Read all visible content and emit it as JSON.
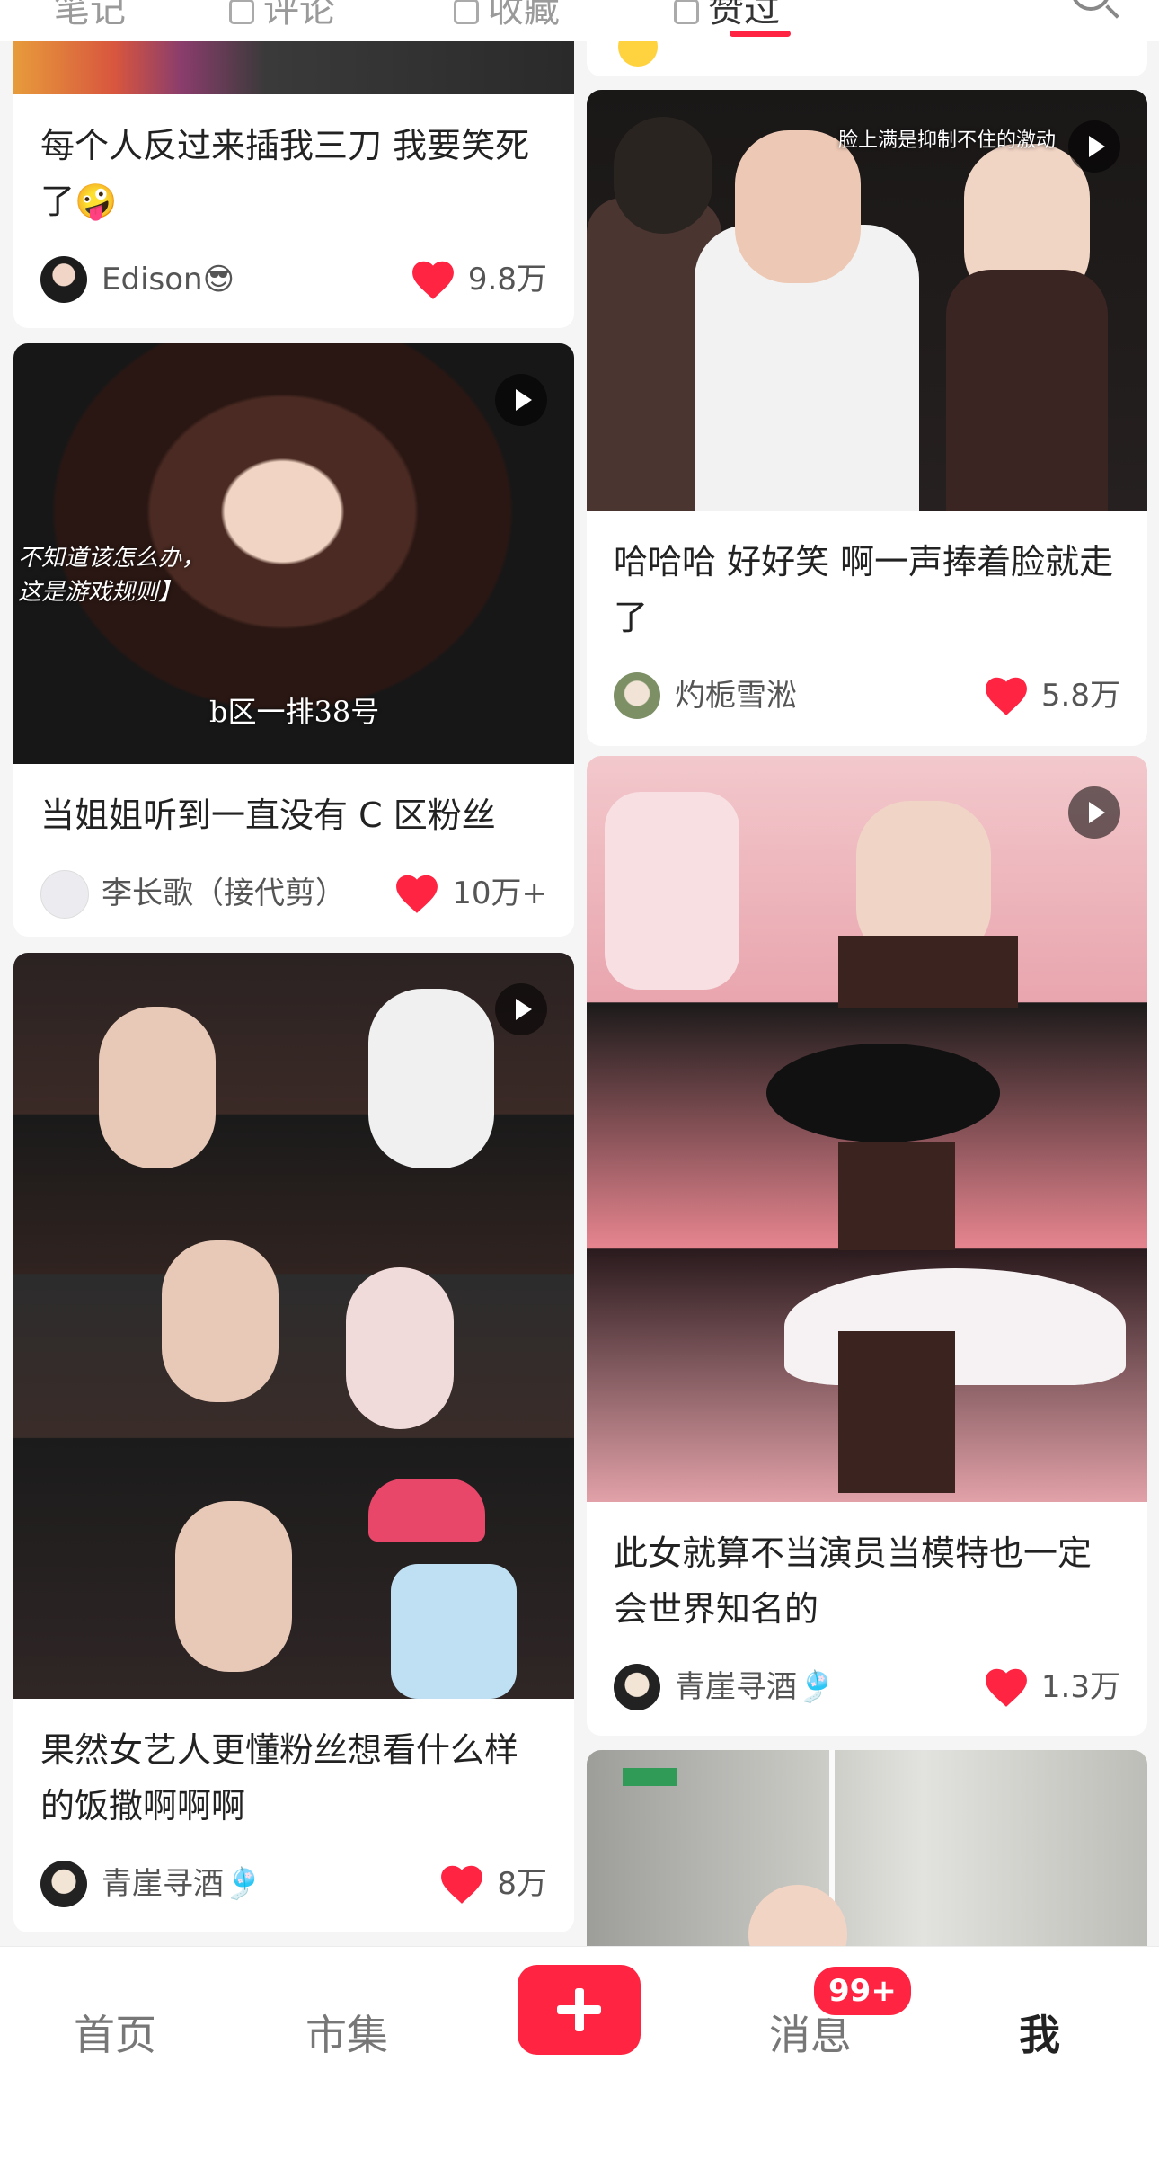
{
  "tabs": [
    {
      "label": "笔记"
    },
    {
      "label": "评论"
    },
    {
      "label": "收藏"
    },
    {
      "label": "赞过"
    }
  ],
  "feed": {
    "left": [
      {
        "title": "每个人反过来插我三刀 我要笑死了🤪",
        "author": "Edison😎",
        "likes": "9.8万"
      },
      {
        "title": "当姐姐听到一直没有 C 区粉丝",
        "author": "李长歌（接代剪）",
        "likes": "10万+",
        "overlay_left": "不知道该怎么办，这是游戏规则】",
        "overlay_bottom": "b区一排38号"
      },
      {
        "title": "果然女艺人更懂粉丝想看什么样的饭撒啊啊啊",
        "author": "青崖寻酒🎐",
        "likes": "8万"
      }
    ],
    "right": [
      {
        "title": "哈哈哈 好好笑 啊一声捧着脸就走了",
        "author": "灼栀雪淞",
        "likes": "5.8万",
        "overlay_top": "脸上满是抑制不住的激动"
      },
      {
        "title": "此女就算不当演员当模特也一定会世界知名的",
        "author": "青崖寻酒🎐",
        "likes": "1.3万"
      }
    ]
  },
  "bottom_nav": {
    "home": "首页",
    "market": "市集",
    "messages": "消息",
    "messages_badge": "99+",
    "me": "我"
  },
  "colors": {
    "accent": "#ff2442",
    "background": "#f5f5f5"
  }
}
